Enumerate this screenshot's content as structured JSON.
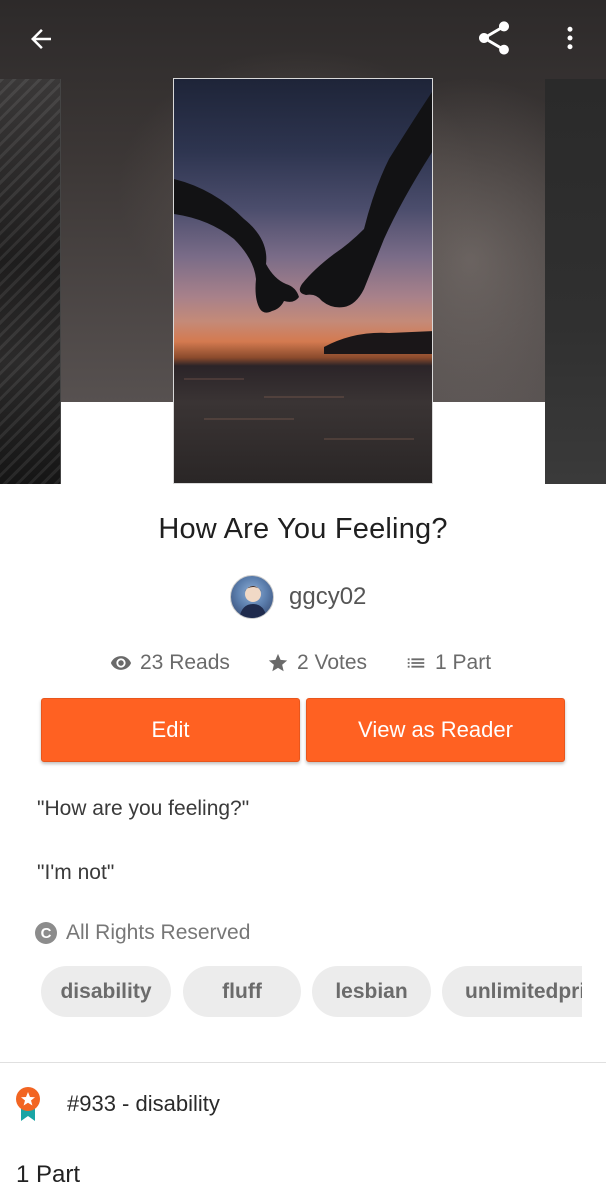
{
  "header": {
    "back_icon": "arrow-left-icon",
    "share_icon": "share-icon",
    "more_icon": "more-vertical-icon"
  },
  "story": {
    "title": "How Are You Feeling?",
    "author": "ggcy02"
  },
  "stats": {
    "reads": "23 Reads",
    "votes": "2 Votes",
    "parts": "1 Part"
  },
  "actions": {
    "edit_label": "Edit",
    "view_label": "View as Reader"
  },
  "description": {
    "line1": "\"How are you feeling?\"",
    "line2": "\"I'm not\""
  },
  "rights": {
    "icon_glyph": "C",
    "label": "All Rights Reserved"
  },
  "tags": [
    "disability",
    "fluff",
    "lesbian",
    "unlimitedpride"
  ],
  "ranking": {
    "label": "#933 - disability"
  },
  "parts_section": {
    "heading": "1 Part"
  },
  "colors": {
    "accent": "#ff6122",
    "tag_bg": "#ececec",
    "rank_badge": "#f26522",
    "rank_ribbon": "#1aa5a5"
  }
}
